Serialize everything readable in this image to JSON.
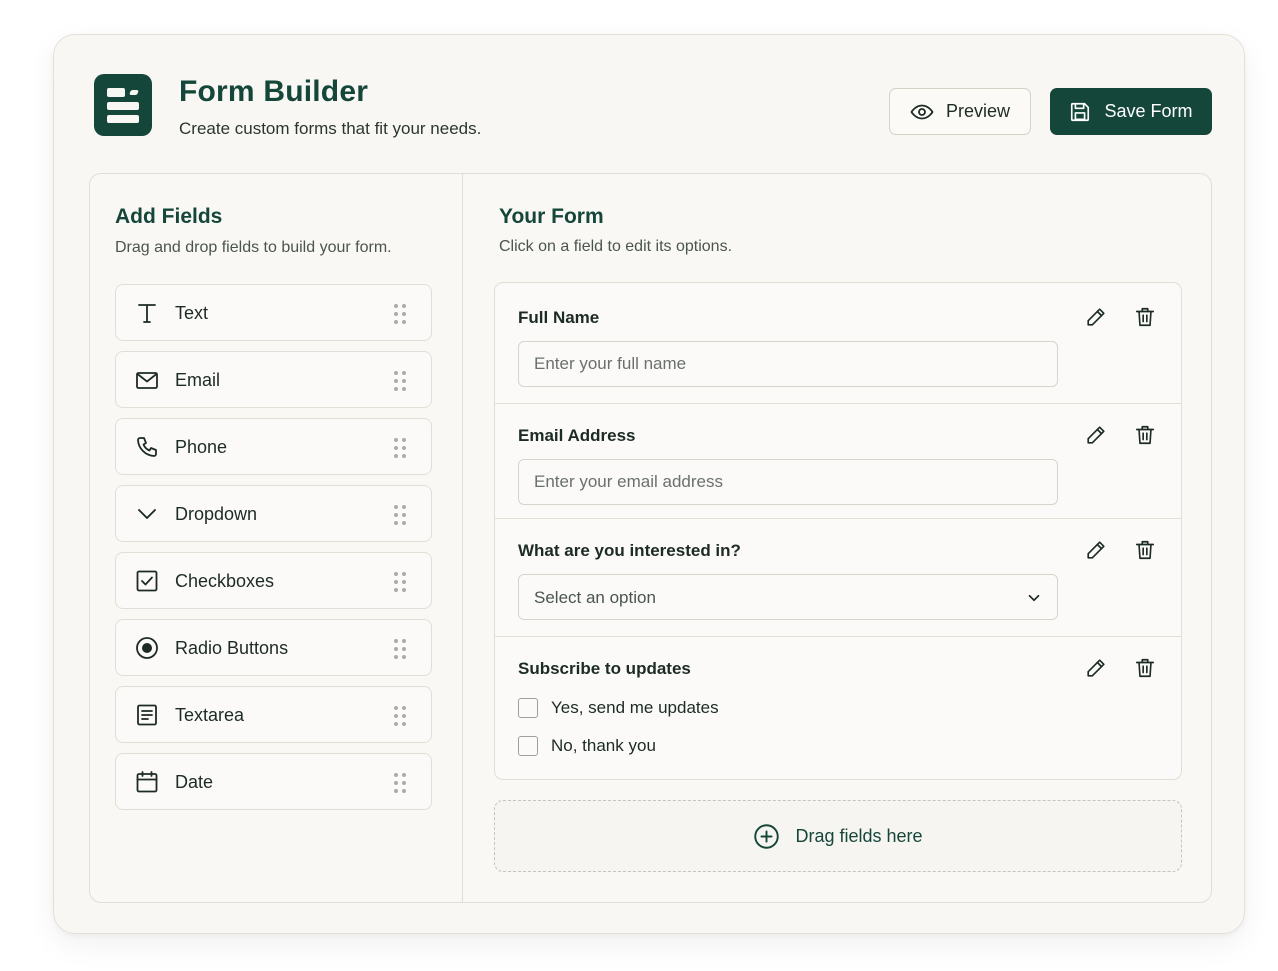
{
  "app": {
    "title": "Form Builder",
    "subtitle": "Create custom forms that fit your needs.",
    "logo_icon": "form-document-icon"
  },
  "header": {
    "preview_label": "Preview",
    "preview_icon": "eye-icon",
    "save_label": "Save Form",
    "save_icon": "floppy-disk-icon"
  },
  "colors": {
    "brand": "#15463a",
    "card_background": "#f9f7f3",
    "border": "#e3ded5"
  },
  "palette": {
    "title": "Add Fields",
    "subtitle": "Drag and drop fields to build your form.",
    "items": [
      {
        "label": "Text",
        "icon": "text-t-icon"
      },
      {
        "label": "Email",
        "icon": "envelope-icon"
      },
      {
        "label": "Phone",
        "icon": "phone-icon"
      },
      {
        "label": "Dropdown",
        "icon": "chevron-down-icon"
      },
      {
        "label": "Checkboxes",
        "icon": "checkbox-icon"
      },
      {
        "label": "Radio Buttons",
        "icon": "radio-icon"
      },
      {
        "label": "Textarea",
        "icon": "textarea-icon"
      },
      {
        "label": "Date",
        "icon": "calendar-icon"
      }
    ]
  },
  "form": {
    "title": "Your Form",
    "subtitle": "Click on a field to edit its options.",
    "fields": [
      {
        "label": "Full Name",
        "type": "text",
        "placeholder": "Enter your full name"
      },
      {
        "label": "Email Address",
        "type": "email",
        "placeholder": "Enter your email address"
      },
      {
        "label": "What are you interested in?",
        "type": "dropdown",
        "placeholder": "Select an option"
      },
      {
        "label": "Subscribe to updates",
        "type": "checkboxes",
        "options": [
          "Yes, send me updates",
          "No, thank you"
        ]
      }
    ],
    "dropzone_label": "Drag fields here",
    "dropzone_icon": "plus-circle-icon"
  }
}
